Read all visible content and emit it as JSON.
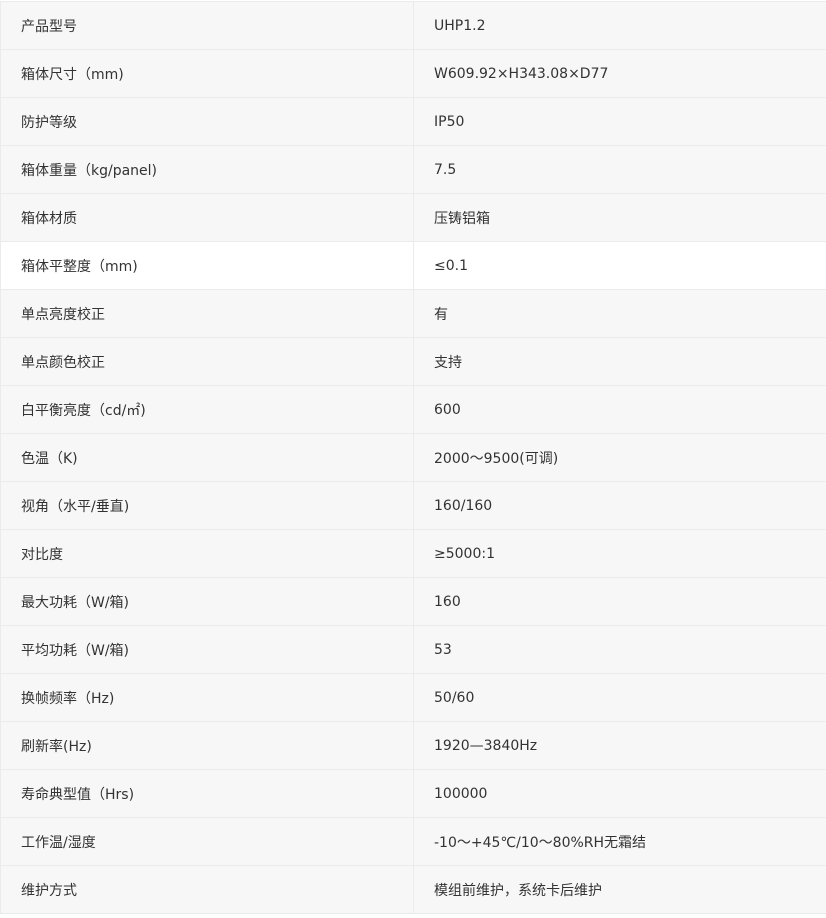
{
  "specs": [
    {
      "label": "产品型号",
      "value": "UHP1.2"
    },
    {
      "label": "箱体尺寸（mm)",
      "value": "W609.92×H343.08×D77"
    },
    {
      "label": "防护等级",
      "value": "IP50"
    },
    {
      "label": "箱体重量（kg/panel)",
      "value": "7.5"
    },
    {
      "label": "箱体材质",
      "value": "压铸铝箱"
    },
    {
      "label": "箱体平整度（mm)",
      "value": "≤0.1"
    },
    {
      "label": "单点亮度校正",
      "value": "有"
    },
    {
      "label": "单点颜色校正",
      "value": "支持"
    },
    {
      "label": "白平衡亮度（cd/㎡)",
      "value": "600"
    },
    {
      "label": "色温（K)",
      "value": "2000～9500(可调)"
    },
    {
      "label": "视角（水平/垂直)",
      "value": "160/160"
    },
    {
      "label": "对比度",
      "value": "≥5000:1"
    },
    {
      "label": "最大功耗（W/箱)",
      "value": "160"
    },
    {
      "label": "平均功耗（W/箱)",
      "value": "53"
    },
    {
      "label": "换帧频率（Hz)",
      "value": "50/60"
    },
    {
      "label": "刷新率(Hz)",
      "value": "1920—3840Hz"
    },
    {
      "label": "寿命典型值（Hrs)",
      "value": "100000"
    },
    {
      "label": "工作温/湿度",
      "value": "-10～+45℃/10～80%RH无霜结"
    },
    {
      "label": "维护方式",
      "value": "模组前维护，系统卡后维护"
    }
  ]
}
